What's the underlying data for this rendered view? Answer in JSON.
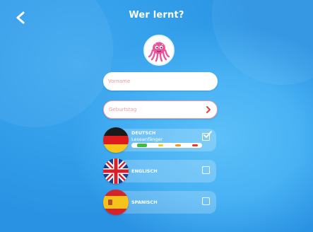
{
  "header": {
    "title": "Wer lernt?"
  },
  "form": {
    "name_placeholder": "Vorname",
    "birthday_placeholder": "Geburtstag"
  },
  "languages": [
    {
      "name": "DEUTSCH",
      "level": "Leseanfänger",
      "checked": true
    },
    {
      "name": "ENGLISCH",
      "checked": false
    },
    {
      "name": "SPANISCH",
      "checked": false
    }
  ],
  "level_colors": [
    "#3fbd3f",
    "#f0d020",
    "#f29a1f",
    "#e23a2f"
  ],
  "colors": {
    "background": "#3aa4ee",
    "accent": "#e26d76"
  }
}
